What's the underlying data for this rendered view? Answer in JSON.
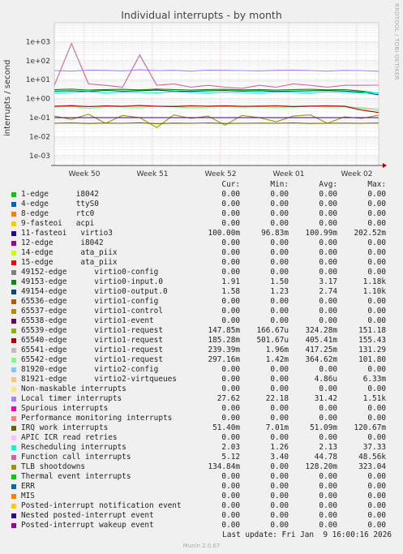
{
  "page": {
    "title": "Individual interrupts - by month",
    "side_label": "RRDTOOL / TOBI OETIKER",
    "last_update": "Last update: Fri Jan  9 16:00:16 2026",
    "munin_version": "Munin 2.0.67"
  },
  "legend_header": {
    "cur": "Cur:",
    "min": "Min:",
    "avg": "Avg:",
    "max": "Max:"
  },
  "legend": [
    {
      "label": "1-edge      i8042",
      "color": "#00cc00",
      "cur": "0.00",
      "min": "0.00",
      "avg": "0.00",
      "max": "0.00"
    },
    {
      "label": "4-edge      ttyS0",
      "color": "#0066b3",
      "cur": "0.00",
      "min": "0.00",
      "avg": "0.00",
      "max": "0.00"
    },
    {
      "label": "8-edge      rtc0",
      "color": "#ff8000",
      "cur": "0.00",
      "min": "0.00",
      "avg": "0.00",
      "max": "0.00"
    },
    {
      "label": "9-fasteoi   acpi",
      "color": "#ffcc00",
      "cur": "0.00",
      "min": "0.00",
      "avg": "0.00",
      "max": "0.00"
    },
    {
      "label": "11-fasteoi   virtio3",
      "color": "#330099",
      "cur": "100.00m",
      "min": "96.83m",
      "avg": "100.99m",
      "max": "202.52m"
    },
    {
      "label": "12-edge      i8042",
      "color": "#990099",
      "cur": "0.00",
      "min": "0.00",
      "avg": "0.00",
      "max": "0.00"
    },
    {
      "label": "14-edge      ata_piix",
      "color": "#ccff00",
      "cur": "0.00",
      "min": "0.00",
      "avg": "0.00",
      "max": "0.00"
    },
    {
      "label": "15-edge      ata_piix",
      "color": "#ff0000",
      "cur": "0.00",
      "min": "0.00",
      "avg": "0.00",
      "max": "0.00"
    },
    {
      "label": "49152-edge      virtio0-config",
      "color": "#808080",
      "cur": "0.00",
      "min": "0.00",
      "avg": "0.00",
      "max": "0.00"
    },
    {
      "label": "49153-edge      virtio0-input.0",
      "color": "#008f00",
      "cur": "1.91",
      "min": "1.50",
      "avg": "3.17",
      "max": "1.18k"
    },
    {
      "label": "49154-edge      virtio0-output.0",
      "color": "#00487d",
      "cur": "1.58",
      "min": "1.23",
      "avg": "2.74",
      "max": "1.10k"
    },
    {
      "label": "65536-edge      virtio1-config",
      "color": "#b35a00",
      "cur": "0.00",
      "min": "0.00",
      "avg": "0.00",
      "max": "0.00"
    },
    {
      "label": "65537-edge      virtio1-control",
      "color": "#b38f00",
      "cur": "0.00",
      "min": "0.00",
      "avg": "0.00",
      "max": "0.00"
    },
    {
      "label": "65538-edge      virtio1-event",
      "color": "#6b006b",
      "cur": "0.00",
      "min": "0.00",
      "avg": "0.00",
      "max": "0.00"
    },
    {
      "label": "65539-edge      virtio1-request",
      "color": "#8fb300",
      "cur": "147.85m",
      "min": "166.67u",
      "avg": "324.28m",
      "max": "151.18"
    },
    {
      "label": "65540-edge      virtio1-request",
      "color": "#b30000",
      "cur": "185.28m",
      "min": "501.67u",
      "avg": "405.41m",
      "max": "155.43"
    },
    {
      "label": "65541-edge      virtio1-request",
      "color": "#bebebe",
      "cur": "239.39m",
      "min": "1.96m",
      "avg": "417.25m",
      "max": "131.29"
    },
    {
      "label": "65542-edge      virtio1-request",
      "color": "#80ff80",
      "cur": "297.16m",
      "min": "1.42m",
      "avg": "364.62m",
      "max": "101.80"
    },
    {
      "label": "81920-edge      virtio2-config",
      "color": "#80c9ff",
      "cur": "0.00",
      "min": "0.00",
      "avg": "0.00",
      "max": "0.00"
    },
    {
      "label": "81921-edge      virtio2-virtqueues",
      "color": "#ffc080",
      "cur": "0.00",
      "min": "0.00",
      "avg": "4.86u",
      "max": "6.33m"
    },
    {
      "label": "Non-maskable interrupts",
      "color": "#ffe680",
      "cur": "0.00",
      "min": "0.00",
      "avg": "0.00",
      "max": "0.00"
    },
    {
      "label": "Local timer interrupts",
      "color": "#aa80ff",
      "cur": "27.62",
      "min": "22.18",
      "avg": "31.42",
      "max": "1.51k"
    },
    {
      "label": "Spurious interrupts",
      "color": "#ee00cc",
      "cur": "0.00",
      "min": "0.00",
      "avg": "0.00",
      "max": "0.00"
    },
    {
      "label": "Performance monitoring interrupts",
      "color": "#ff8080",
      "cur": "0.00",
      "min": "0.00",
      "avg": "0.00",
      "max": "0.00"
    },
    {
      "label": "IRQ work interrupts",
      "color": "#666600",
      "cur": "51.40m",
      "min": "7.01m",
      "avg": "51.09m",
      "max": "120.67m"
    },
    {
      "label": "APIC ICR read retries",
      "color": "#ffbfff",
      "cur": "0.00",
      "min": "0.00",
      "avg": "0.00",
      "max": "0.00"
    },
    {
      "label": "Rescheduling interrupts",
      "color": "#00ffcc",
      "cur": "2.03",
      "min": "1.26",
      "avg": "2.13",
      "max": "37.33"
    },
    {
      "label": "Function call interrupts",
      "color": "#cc6699",
      "cur": "5.12",
      "min": "3.40",
      "avg": "44.78",
      "max": "48.56k"
    },
    {
      "label": "TLB shootdowns",
      "color": "#999900",
      "cur": "134.84m",
      "min": "0.00",
      "avg": "128.20m",
      "max": "323.04"
    },
    {
      "label": "Thermal event interrupts",
      "color": "#00cc00",
      "cur": "0.00",
      "min": "0.00",
      "avg": "0.00",
      "max": "0.00"
    },
    {
      "label": "ERR",
      "color": "#0066b3",
      "cur": "0.00",
      "min": "0.00",
      "avg": "0.00",
      "max": "0.00"
    },
    {
      "label": "MIS",
      "color": "#ff8000",
      "cur": "0.00",
      "min": "0.00",
      "avg": "0.00",
      "max": "0.00"
    },
    {
      "label": "Posted-interrupt notification event",
      "color": "#ffcc00",
      "cur": "0.00",
      "min": "0.00",
      "avg": "0.00",
      "max": "0.00"
    },
    {
      "label": "Nested posted-interrupt event",
      "color": "#330099",
      "cur": "0.00",
      "min": "0.00",
      "avg": "0.00",
      "max": "0.00"
    },
    {
      "label": "Posted-interrupt wakeup event",
      "color": "#990099",
      "cur": "0.00",
      "min": "0.00",
      "avg": "0.00",
      "max": "0.00"
    }
  ],
  "chart_data": {
    "type": "line",
    "title": "Individual interrupts - by month",
    "ylabel": "interrupts / second",
    "yscale": "log",
    "ylim": [
      0.0003,
      10000
    ],
    "yticks": [
      "1e-03",
      "1e-02",
      "1e-01",
      "1e+00",
      "1e+01",
      "1e+02",
      "1e+03"
    ],
    "xticks": [
      "Week 50",
      "Week 51",
      "Week 52",
      "Week 01",
      "Week 02"
    ],
    "grid": true,
    "series": [
      {
        "name": "Local timer interrupts",
        "color": "#aa80ff",
        "values": [
          30,
          28,
          32,
          31,
          29,
          33,
          30,
          31,
          28,
          32,
          31,
          30,
          29,
          31,
          32,
          30,
          28,
          31,
          30,
          27.62
        ]
      },
      {
        "name": "Function call interrupts",
        "color": "#cc6699",
        "values": [
          5,
          800,
          6,
          5,
          4,
          200,
          5,
          6,
          4,
          5,
          4,
          3.5,
          5,
          4,
          6,
          5,
          4,
          5,
          5,
          5.12
        ]
      },
      {
        "name": "49153-edge      virtio0-input.0",
        "color": "#008f00",
        "values": [
          3,
          3.2,
          2.8,
          3,
          3.1,
          2.9,
          3.2,
          3,
          2.8,
          3,
          3.1,
          2.9,
          3,
          2.8,
          3,
          3.1,
          2.9,
          3,
          2.5,
          1.91
        ]
      },
      {
        "name": "49154-edge      virtio0-output.0",
        "color": "#00487d",
        "values": [
          2.5,
          2.6,
          2.4,
          2.7,
          2.5,
          2.6,
          2.8,
          2.5,
          2.4,
          2.6,
          2.7,
          2.5,
          2.6,
          2.4,
          2.5,
          2.6,
          2.7,
          2.5,
          2.2,
          1.58
        ]
      },
      {
        "name": "Rescheduling interrupts",
        "color": "#00ffcc",
        "values": [
          2,
          2.1,
          2.3,
          2,
          2.2,
          2.1,
          2,
          2.3,
          2.1,
          2,
          2.2,
          2.1,
          2,
          2.2,
          2.1,
          2,
          2.3,
          2.1,
          2,
          2.03
        ]
      },
      {
        "name": "65542-edge      virtio1-request",
        "color": "#80ff80",
        "values": [
          0.35,
          0.4,
          0.3,
          0.38,
          0.36,
          0.34,
          0.4,
          0.37,
          0.33,
          0.36,
          0.38,
          0.35,
          0.37,
          0.34,
          0.36,
          0.39,
          0.35,
          0.37,
          0.33,
          0.297
        ]
      },
      {
        "name": "65541-edge      virtio1-request",
        "color": "#bebebe",
        "values": [
          0.4,
          0.45,
          0.38,
          0.42,
          0.4,
          0.44,
          0.39,
          0.41,
          0.43,
          0.4,
          0.42,
          0.38,
          0.41,
          0.43,
          0.4,
          0.42,
          0.39,
          0.41,
          0.3,
          0.239
        ]
      },
      {
        "name": "65540-edge      virtio1-request",
        "color": "#b30000",
        "values": [
          0.4,
          0.42,
          0.38,
          0.41,
          0.39,
          0.43,
          0.4,
          0.38,
          0.41,
          0.4,
          0.42,
          0.39,
          0.4,
          0.41,
          0.38,
          0.4,
          0.42,
          0.39,
          0.25,
          0.185
        ]
      },
      {
        "name": "TLB shootdowns",
        "color": "#999900",
        "values": [
          0.12,
          0.08,
          0.15,
          0.05,
          0.13,
          0.1,
          0.03,
          0.14,
          0.09,
          0.12,
          0.04,
          0.13,
          0.1,
          0.06,
          0.12,
          0.14,
          0.05,
          0.11,
          0.09,
          0.135
        ]
      },
      {
        "name": "11-fasteoi   virtio3",
        "color": "#330099",
        "values": [
          0.1,
          0.1,
          0.1,
          0.1,
          0.1,
          0.1,
          0.1,
          0.1,
          0.1,
          0.1,
          0.1,
          0.1,
          0.1,
          0.1,
          0.1,
          0.1,
          0.1,
          0.1,
          0.1,
          0.1
        ]
      },
      {
        "name": "IRQ work interrupts",
        "color": "#666600",
        "values": [
          0.05,
          0.052,
          0.049,
          0.051,
          0.05,
          0.053,
          0.048,
          0.051,
          0.05,
          0.052,
          0.049,
          0.05,
          0.051,
          0.05,
          0.052,
          0.049,
          0.05,
          0.051,
          0.05,
          0.0514
        ]
      }
    ]
  }
}
